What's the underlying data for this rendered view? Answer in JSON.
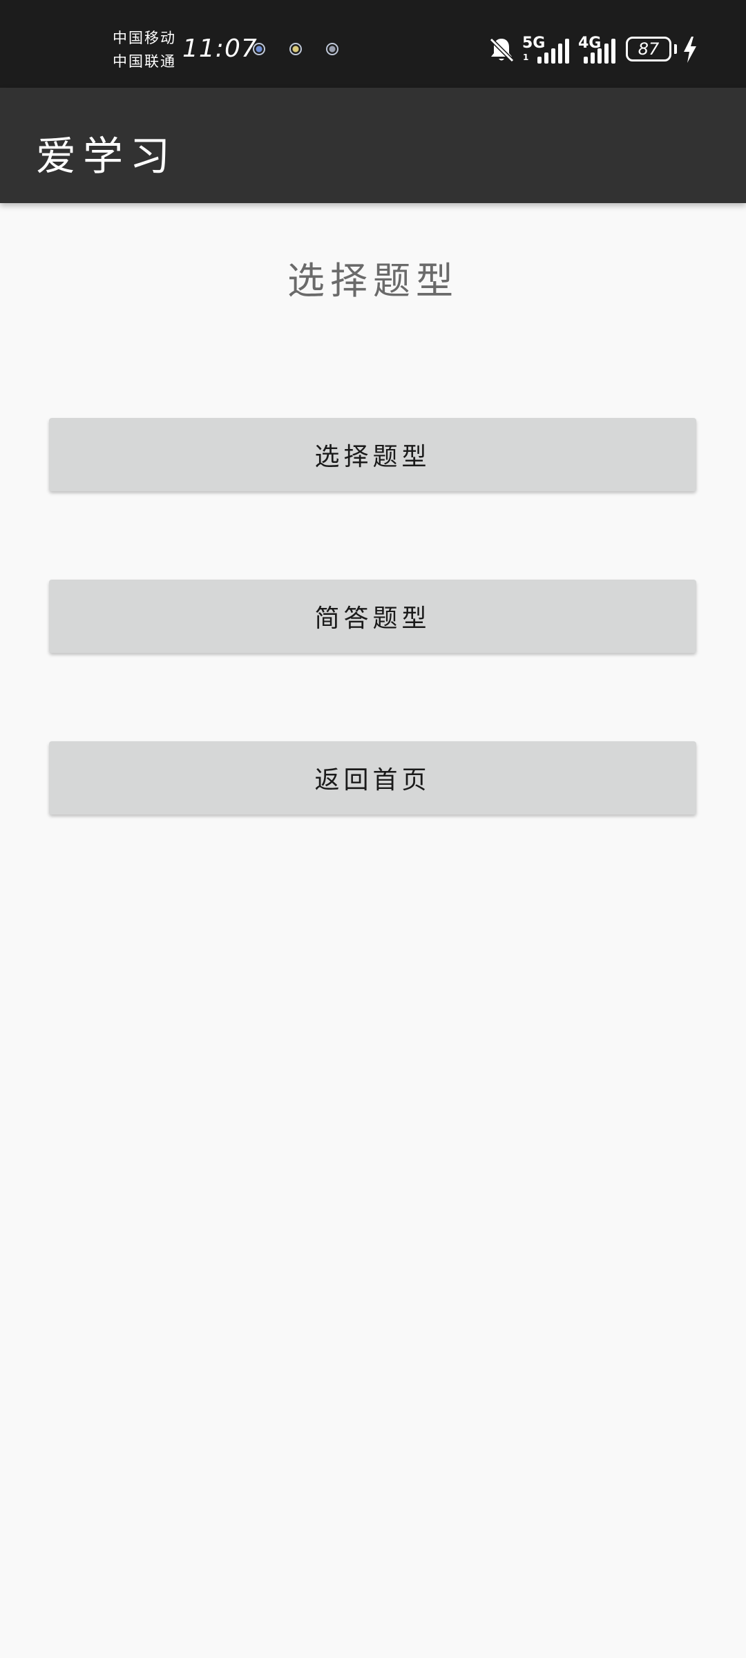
{
  "status_bar": {
    "carrier_1": "中国移动",
    "carrier_2": "中国联通",
    "time": "11:07",
    "network_1": "5G",
    "network_1_sub": "1",
    "network_2": "4G",
    "battery": "87",
    "icons": [
      "notification-app-icon",
      "notification-app-icon",
      "notification-app-icon",
      "bell-off-icon",
      "signal-icon",
      "signal-icon",
      "battery-icon",
      "charging-bolt-icon"
    ]
  },
  "app_bar": {
    "title": "爱学习"
  },
  "main": {
    "heading": "选择题型",
    "buttons": [
      {
        "label": "选择题型"
      },
      {
        "label": "简答题型"
      },
      {
        "label": "返回首页"
      }
    ]
  },
  "colors": {
    "status_bar_bg": "#1c1c1c",
    "app_bar_bg": "#323232",
    "page_bg": "#f9f9f9",
    "button_bg": "#d6d7d7",
    "heading_text": "#6a6a6a"
  }
}
